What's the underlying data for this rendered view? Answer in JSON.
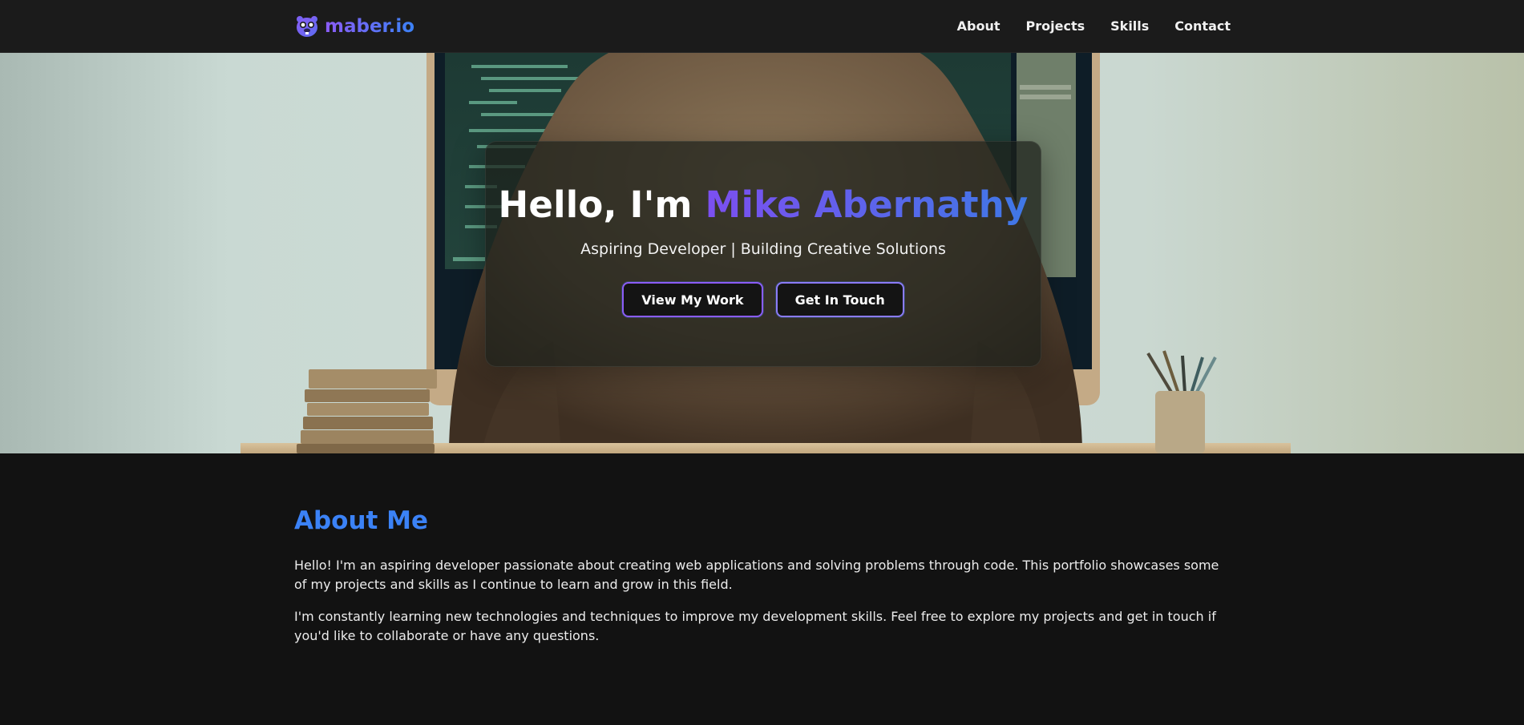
{
  "nav": {
    "brand": "maber.io",
    "links": [
      "About",
      "Projects",
      "Skills",
      "Contact"
    ]
  },
  "hero": {
    "greeting": "Hello, I'm",
    "name": "Mike Abernathy",
    "subtitle": "Aspiring Developer | Building Creative Solutions",
    "buttons": [
      "View My Work",
      "Get In Touch"
    ]
  },
  "about": {
    "title": "About Me",
    "paragraphs": [
      "Hello! I'm an aspiring developer passionate about creating web applications and solving problems through code. This portfolio showcases some of my projects and skills as I continue to learn and grow in this field.",
      "I'm constantly learning new technologies and techniques to improve my development skills. Feel free to explore my projects and get in touch if you'd like to collaborate or have any questions."
    ]
  },
  "colors": {
    "accent_purple": "#8b5cf6",
    "accent_blue": "#3b82f6",
    "background": "#121212",
    "navbar": "#1b1b1b"
  },
  "icons": {
    "brand": "beaver-logo-icon"
  }
}
